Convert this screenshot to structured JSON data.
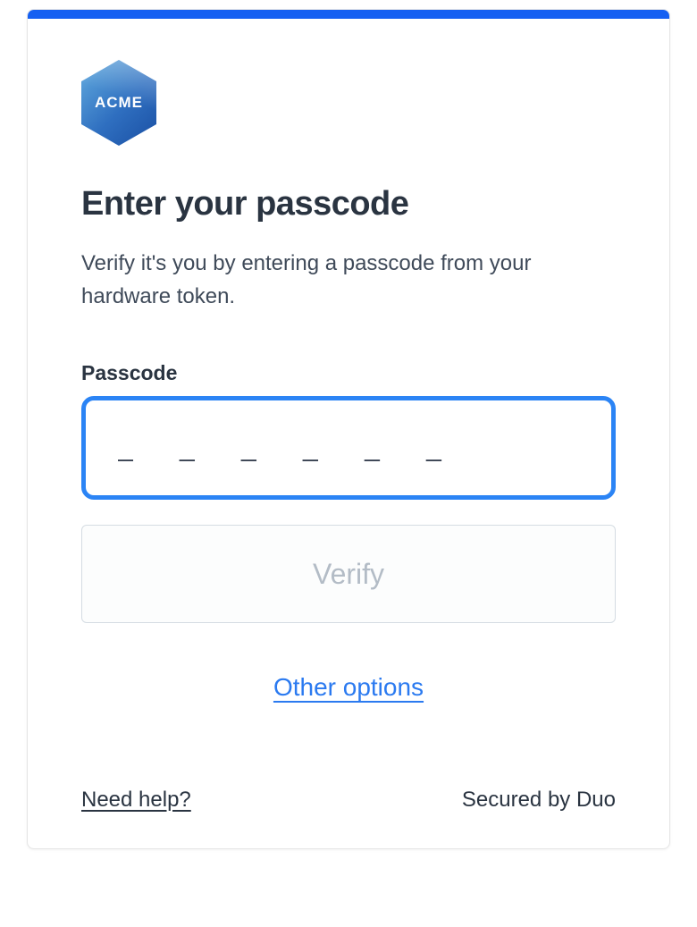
{
  "logo": {
    "text": "ACME"
  },
  "heading": "Enter your passcode",
  "subtitle": "Verify it's you by entering a passcode from your hardware token.",
  "passcode": {
    "label": "Passcode",
    "placeholder": "_ _ _ _ _ _",
    "value": ""
  },
  "verify_button": "Verify",
  "other_options": "Other options",
  "footer": {
    "help": "Need help?",
    "secured": "Secured by Duo"
  }
}
